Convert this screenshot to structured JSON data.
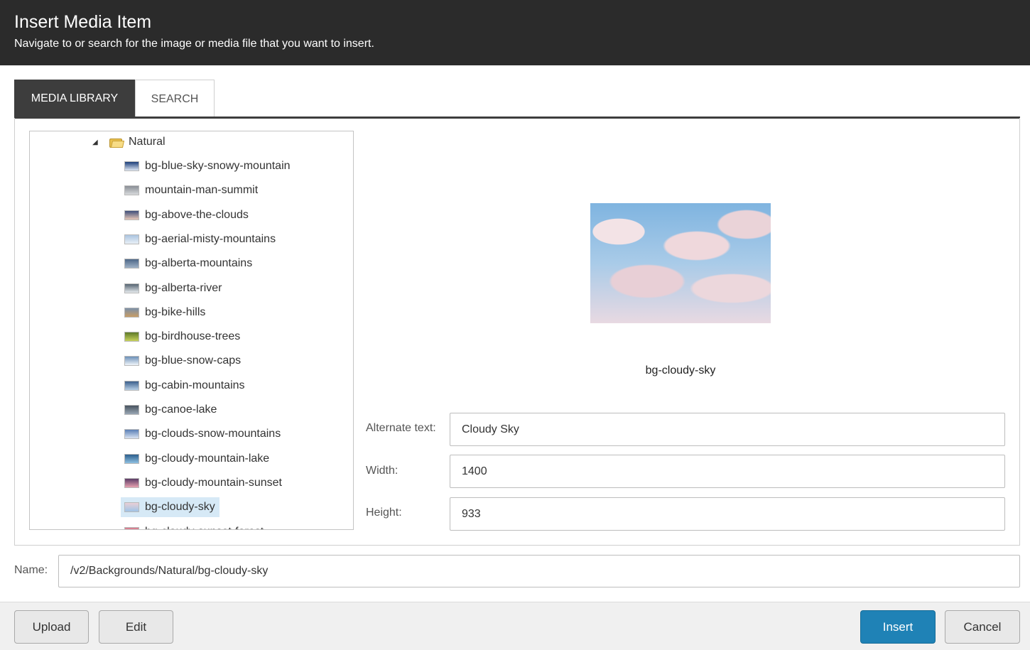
{
  "dialog": {
    "title": "Insert Media Item",
    "subtitle": "Navigate to or search for the image or media file that you want to insert."
  },
  "tabs": [
    {
      "label": "MEDIA LIBRARY",
      "active": true
    },
    {
      "label": "SEARCH",
      "active": false
    }
  ],
  "tree": {
    "root": {
      "label": "Natural",
      "icon": "folder-icon",
      "expanded": true
    },
    "items": [
      {
        "label": "bg-blue-sky-snowy-mountain",
        "thumb": [
          "#1c3f7a",
          "#dfe8f5"
        ]
      },
      {
        "label": "mountain-man-summit",
        "thumb": [
          "#8a8f96",
          "#d8dadc"
        ]
      },
      {
        "label": "bg-above-the-clouds",
        "thumb": [
          "#3f4f7a",
          "#e7c7b7"
        ]
      },
      {
        "label": "bg-aerial-misty-mountains",
        "thumb": [
          "#aac4df",
          "#e9f0f7"
        ]
      },
      {
        "label": "bg-alberta-mountains",
        "thumb": [
          "#4d6787",
          "#9fb1c6"
        ]
      },
      {
        "label": "bg-alberta-river",
        "thumb": [
          "#566472",
          "#e6ebee"
        ]
      },
      {
        "label": "bg-bike-hills",
        "thumb": [
          "#7b8fa8",
          "#c89d66"
        ]
      },
      {
        "label": "bg-birdhouse-trees",
        "thumb": [
          "#5e7a2a",
          "#c7d25b"
        ]
      },
      {
        "label": "bg-blue-snow-caps",
        "thumb": [
          "#6c90b8",
          "#f1f5fa"
        ]
      },
      {
        "label": "bg-cabin-mountains",
        "thumb": [
          "#3b5f8c",
          "#b7cfe6"
        ]
      },
      {
        "label": "bg-canoe-lake",
        "thumb": [
          "#48535f",
          "#9aa8b5"
        ]
      },
      {
        "label": "bg-clouds-snow-mountains",
        "thumb": [
          "#5a7fb6",
          "#d9e3f1"
        ]
      },
      {
        "label": "bg-cloudy-mountain-lake",
        "thumb": [
          "#2b5e8c",
          "#8fc0e2"
        ]
      },
      {
        "label": "bg-cloudy-mountain-sunset",
        "thumb": [
          "#5b3b66",
          "#e8a2b0"
        ]
      },
      {
        "label": "bg-cloudy-sky",
        "thumb": [
          "#e9cfd6",
          "#9fc4e6"
        ],
        "selected": true
      },
      {
        "label": "bg-cloudy-sunset-forest",
        "thumb": [
          "#d67a8c",
          "#f0c3c9"
        ]
      }
    ]
  },
  "preview": {
    "caption": "bg-cloudy-sky"
  },
  "fields": {
    "alt_label": "Alternate text:",
    "alt_value": "Cloudy Sky",
    "width_label": "Width:",
    "width_value": "1400",
    "height_label": "Height:",
    "height_value": "933",
    "name_label": "Name:",
    "name_value": "/v2/Backgrounds/Natural/bg-cloudy-sky"
  },
  "buttons": {
    "upload": "Upload",
    "edit": "Edit",
    "insert": "Insert",
    "cancel": "Cancel"
  },
  "colors": {
    "header_bg": "#2b2b2b",
    "active_tab_bg": "#3d3d3d",
    "selected_item_bg": "#d6e9f6",
    "primary_button": "#1f82b6"
  }
}
